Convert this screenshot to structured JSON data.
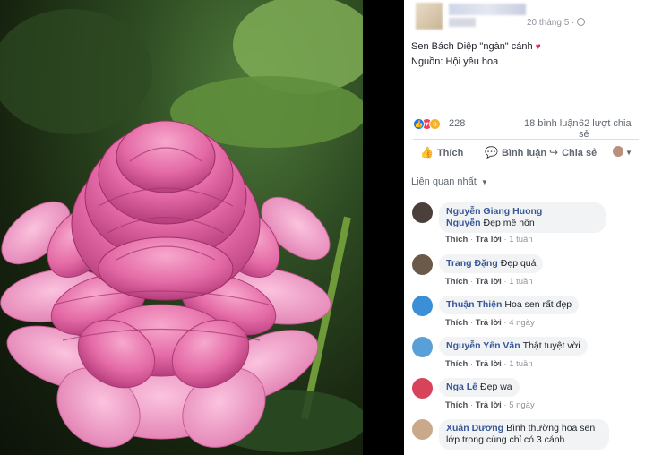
{
  "post": {
    "time": "20 tháng 5 ·",
    "caption_line1": "Sen Bách Diệp \"ngàn\" cánh",
    "caption_line2": "Nguồn: Hội yêu hoa",
    "heart_icon": "♥"
  },
  "stats": {
    "reaction_icons": [
      "like-icon",
      "love-icon",
      "wow-icon"
    ],
    "reaction_count": "228",
    "comments": "18 bình luận",
    "shares": "62 lượt chia sẻ"
  },
  "actions": {
    "like": "Thích",
    "comment": "Bình luận",
    "share": "Chia sẻ"
  },
  "related_label": "Liên quan nhất",
  "comments": [
    {
      "name": "Nguyễn Giang Huong Nguyễn",
      "text": "Đẹp mê hồn",
      "like": "Thích",
      "reply": "Trả lời",
      "time": "1 tuần",
      "avatar_color": "#4a3f3a"
    },
    {
      "name": "Trang Đặng",
      "text": "Đẹp quá",
      "like": "Thích",
      "reply": "Trả lời",
      "time": "1 tuần",
      "avatar_color": "#6b5a4a"
    },
    {
      "name": "Thuận Thiện",
      "text": "Hoa sen rất đẹp",
      "like": "Thích",
      "reply": "Trả lời",
      "time": "4 ngày",
      "avatar_color": "#3b8fd6"
    },
    {
      "name": "Nguyễn Yến Vân",
      "text": "Thật tuyệt vời",
      "like": "Thích",
      "reply": "Trả lời",
      "time": "1 tuần",
      "avatar_color": "#5aa0d8"
    },
    {
      "name": "Nga Lê",
      "text": "Đẹp wa",
      "like": "Thích",
      "reply": "Trả lời",
      "time": "5 ngày",
      "avatar_color": "#d9435a"
    },
    {
      "name": "Xuân Dương",
      "text": "Bình thường hoa sen lớp trong cùng chỉ có 3 cánh",
      "like": "",
      "reply": "",
      "time": "",
      "avatar_color": "#c9a98a"
    }
  ]
}
